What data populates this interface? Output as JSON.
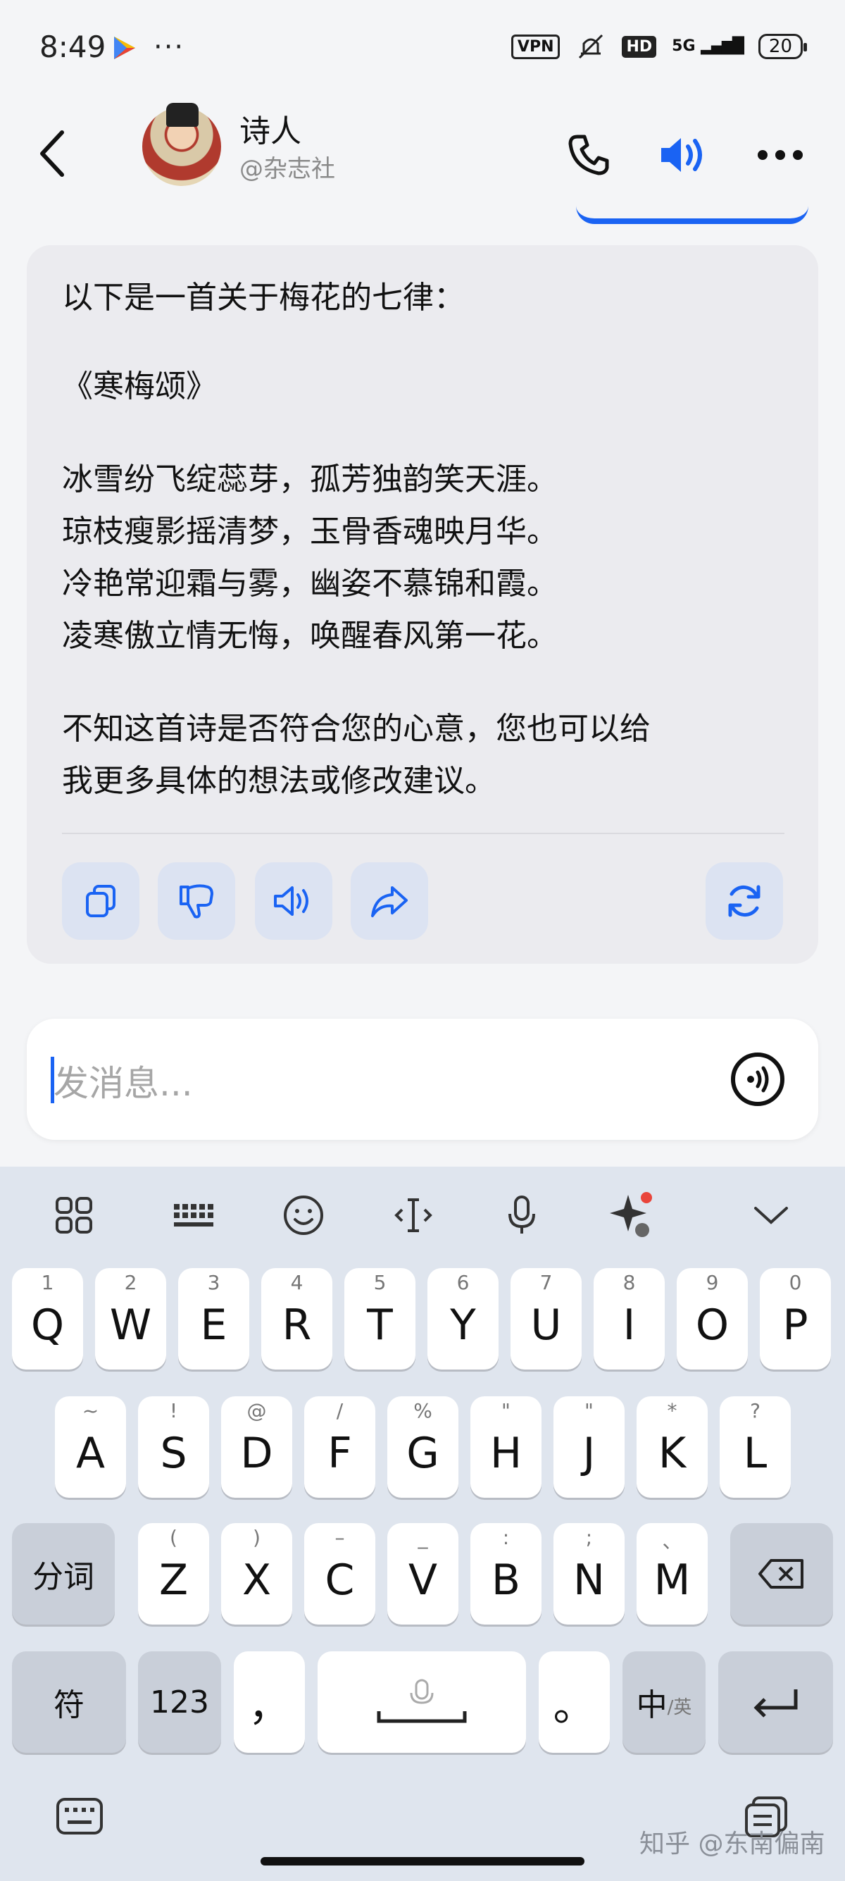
{
  "status_bar": {
    "time": "8:49",
    "more": "···",
    "vpn": "VPN",
    "hd": "HD",
    "network": "5G",
    "battery": "20"
  },
  "header": {
    "name": "诗人",
    "handle": "@杂志社"
  },
  "message": {
    "intro": "以下是一首关于梅花的七律：",
    "title": "《寒梅颂》",
    "lines": [
      "冰雪纷飞绽蕊芽，孤芳独韵笑天涯。",
      "琼枝瘦影摇清梦，玉骨香魂映月华。",
      "冷艳常迎霜与雾，幽姿不慕锦和霞。",
      "凌寒傲立情无悔，唤醒春风第一花。"
    ],
    "closing": [
      "不知这首诗是否符合您的心意，您也可以给",
      "我更多具体的想法或修改建议。"
    ]
  },
  "input": {
    "placeholder": "发消息..."
  },
  "keyboard": {
    "row1": [
      {
        "k": "Q",
        "s": "1"
      },
      {
        "k": "W",
        "s": "2"
      },
      {
        "k": "E",
        "s": "3"
      },
      {
        "k": "R",
        "s": "4"
      },
      {
        "k": "T",
        "s": "5"
      },
      {
        "k": "Y",
        "s": "6"
      },
      {
        "k": "U",
        "s": "7"
      },
      {
        "k": "I",
        "s": "8"
      },
      {
        "k": "O",
        "s": "9"
      },
      {
        "k": "P",
        "s": "0"
      }
    ],
    "row2": [
      {
        "k": "A",
        "s": "~"
      },
      {
        "k": "S",
        "s": "!"
      },
      {
        "k": "D",
        "s": "@"
      },
      {
        "k": "F",
        "s": "/"
      },
      {
        "k": "G",
        "s": "%"
      },
      {
        "k": "H",
        "s": "\""
      },
      {
        "k": "J",
        "s": "\""
      },
      {
        "k": "K",
        "s": "*"
      },
      {
        "k": "L",
        "s": "?"
      }
    ],
    "row3": [
      {
        "k": "Z",
        "s": "("
      },
      {
        "k": "X",
        "s": ")"
      },
      {
        "k": "C",
        "s": "–"
      },
      {
        "k": "V",
        "s": "_"
      },
      {
        "k": "B",
        "s": ":"
      },
      {
        "k": "N",
        "s": ";"
      },
      {
        "k": "M",
        "s": "、"
      }
    ],
    "fenci": "分词",
    "fu": "符",
    "num": "123",
    "comma": "，",
    "period": "。",
    "zh": "中",
    "en": "/英"
  },
  "watermark": "知乎 @东南偏南",
  "colors": {
    "accent": "#1a63f3",
    "card_bg": "#ebebef",
    "keyboard_bg": "#dfe5ee"
  }
}
